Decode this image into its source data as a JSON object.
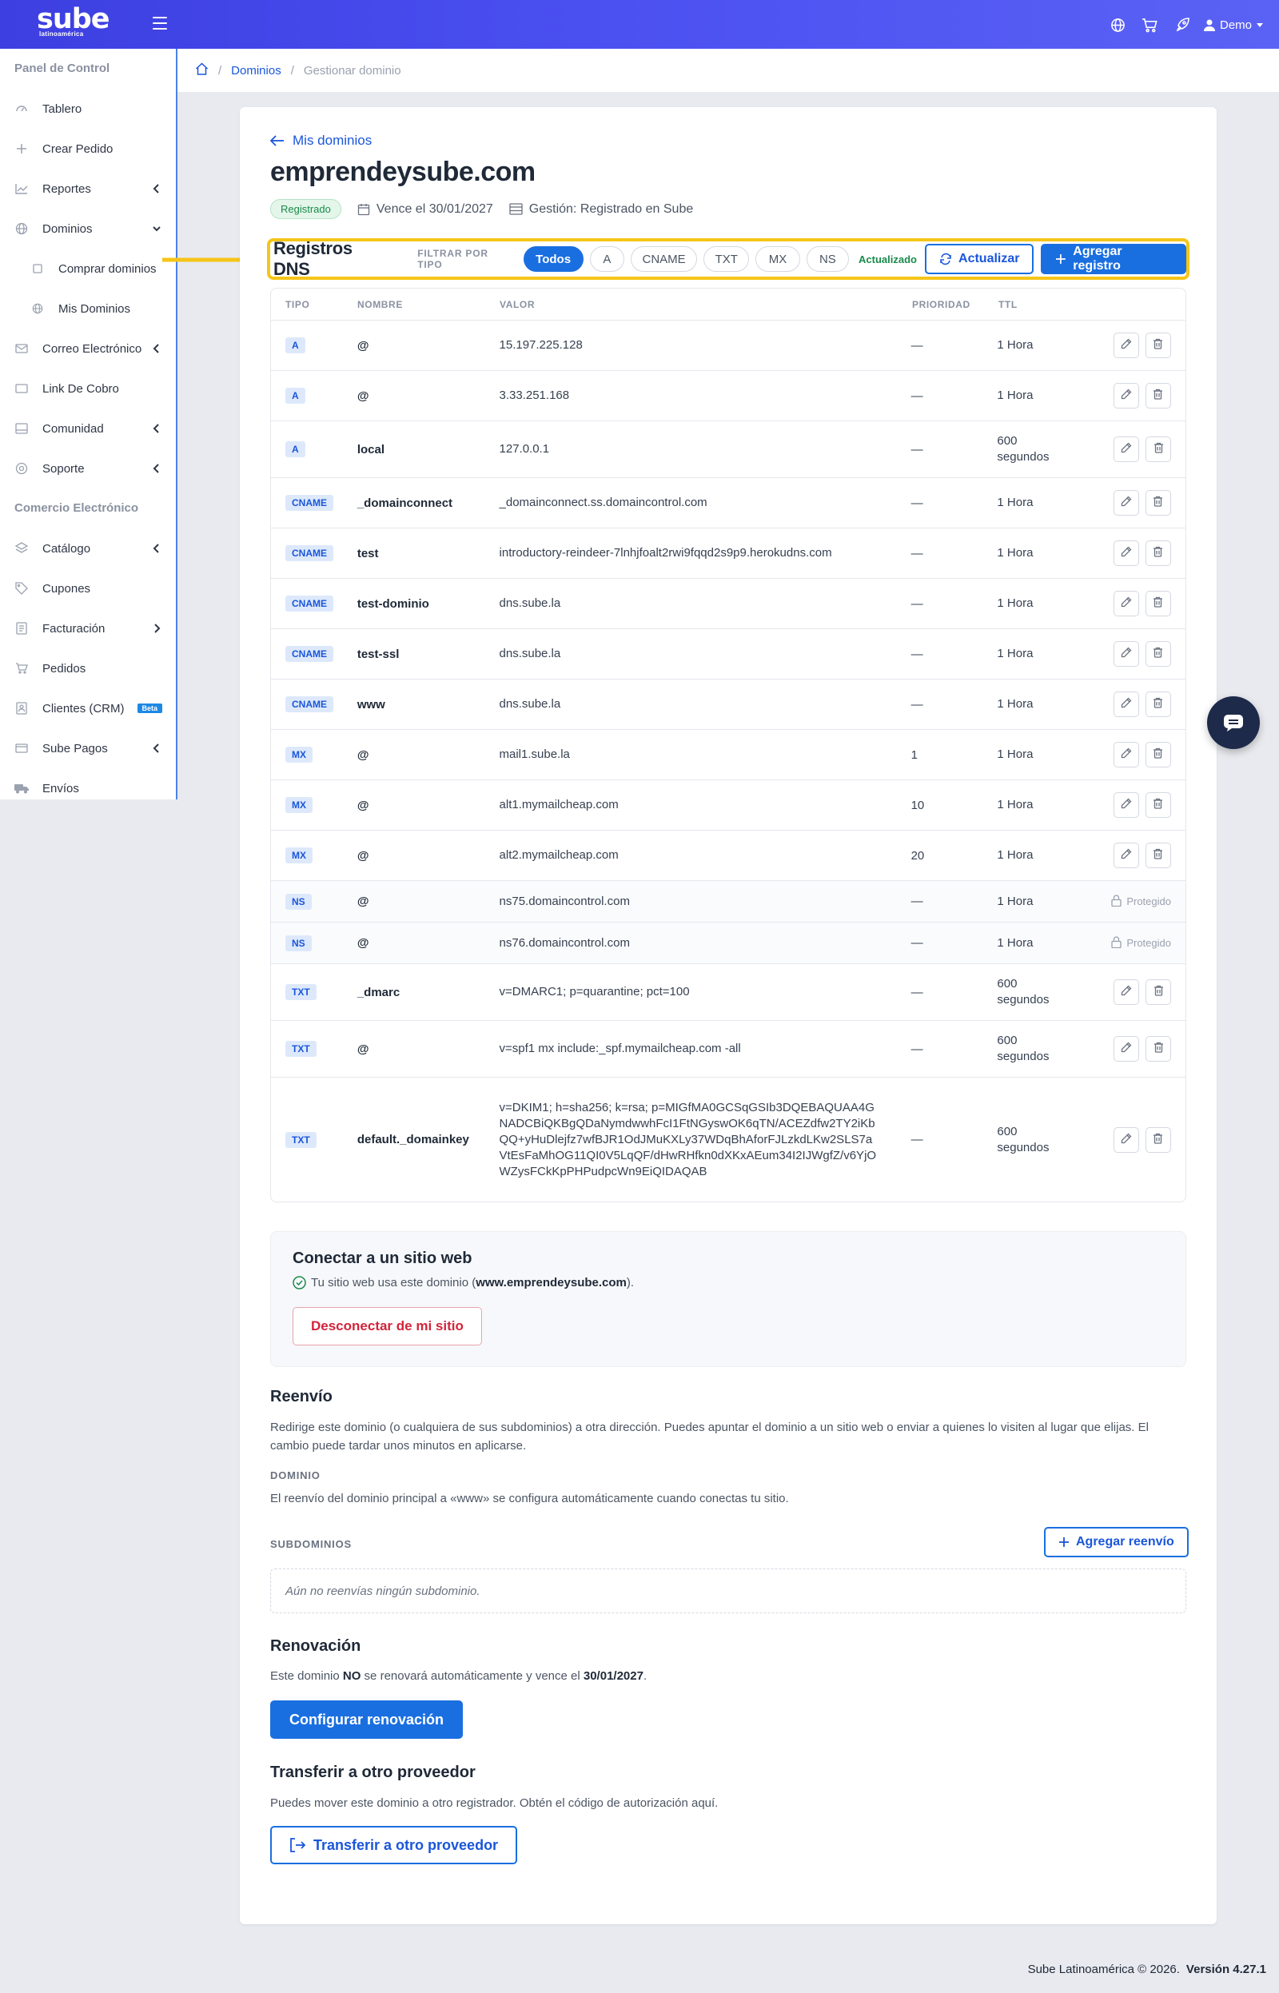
{
  "brand": {
    "logo_main": "sube",
    "logo_sub": "latinoamérica"
  },
  "topbar": {
    "user_label": "Demo"
  },
  "sidebar": {
    "section_panel": "Panel de Control",
    "section_commerce": "Comercio Electrónico",
    "items": [
      {
        "label": "Tablero",
        "icon": "dashboard-icon"
      },
      {
        "label": "Crear Pedido",
        "icon": "plus-icon"
      },
      {
        "label": "Reportes",
        "icon": "chart-icon"
      },
      {
        "label": "Dominios",
        "icon": "globe-icon"
      },
      {
        "label": "Comprar dominios",
        "icon": "cart-icon"
      },
      {
        "label": "Mis Dominios",
        "icon": "globe-icon"
      },
      {
        "label": "Correo Electrónico",
        "icon": "mail-icon"
      },
      {
        "label": "Link De Cobro",
        "icon": "link-icon"
      },
      {
        "label": "Comunidad",
        "icon": "community-icon"
      },
      {
        "label": "Soporte",
        "icon": "support-icon"
      },
      {
        "label": "Catálogo",
        "icon": "layers-icon"
      },
      {
        "label": "Cupones",
        "icon": "tag-icon"
      },
      {
        "label": "Facturación",
        "icon": "invoice-icon"
      },
      {
        "label": "Pedidos",
        "icon": "bag-icon"
      },
      {
        "label": "Clientes (CRM)",
        "icon": "contacts-icon"
      },
      {
        "label": "Sube Pagos",
        "icon": "card-icon"
      },
      {
        "label": "Envíos",
        "icon": "truck-icon"
      }
    ],
    "beta_label": "Beta"
  },
  "breadcrumb": {
    "link": "Dominios",
    "current": "Gestionar dominio"
  },
  "domain": {
    "back_label": "Mis dominios",
    "name": "emprendeysube.com",
    "status": "Registrado",
    "expires": "Vence el 30/01/2027",
    "management": "Gestión: Registrado en Sube"
  },
  "dns": {
    "title": "Registros DNS",
    "filter_label": "FILTRAR POR TIPO",
    "filters": [
      "Todos",
      "A",
      "CNAME",
      "TXT",
      "MX",
      "NS"
    ],
    "updated": "Actualizado",
    "refresh_label": "Actualizar",
    "add_label": "Agregar registro",
    "columns": [
      "TIPO",
      "NOMBRE",
      "VALOR",
      "PRIORIDAD",
      "TTL"
    ],
    "protected_label": "Protegido",
    "rows": [
      {
        "type": "A",
        "name": "@",
        "value": "15.197.225.128",
        "priority": "—",
        "ttl": "1 Hora",
        "locked": false
      },
      {
        "type": "A",
        "name": "@",
        "value": "3.33.251.168",
        "priority": "—",
        "ttl": "1 Hora",
        "locked": false
      },
      {
        "type": "A",
        "name": "local",
        "value": "127.0.0.1",
        "priority": "—",
        "ttl": "600 segundos",
        "locked": false
      },
      {
        "type": "CNAME",
        "name": "_domainconnect",
        "value": "_domainconnect.ss.domaincontrol.com",
        "priority": "—",
        "ttl": "1 Hora",
        "locked": false
      },
      {
        "type": "CNAME",
        "name": "test",
        "value": "introductory-reindeer-7lnhjfoalt2rwi9fqqd2s9p9.herokudns.com",
        "priority": "—",
        "ttl": "1 Hora",
        "locked": false
      },
      {
        "type": "CNAME",
        "name": "test-dominio",
        "value": "dns.sube.la",
        "priority": "—",
        "ttl": "1 Hora",
        "locked": false
      },
      {
        "type": "CNAME",
        "name": "test-ssl",
        "value": "dns.sube.la",
        "priority": "—",
        "ttl": "1 Hora",
        "locked": false
      },
      {
        "type": "CNAME",
        "name": "www",
        "value": "dns.sube.la",
        "priority": "—",
        "ttl": "1 Hora",
        "locked": false
      },
      {
        "type": "MX",
        "name": "@",
        "value": "mail1.sube.la",
        "priority": "1",
        "ttl": "1 Hora",
        "locked": false
      },
      {
        "type": "MX",
        "name": "@",
        "value": "alt1.mymailcheap.com",
        "priority": "10",
        "ttl": "1 Hora",
        "locked": false
      },
      {
        "type": "MX",
        "name": "@",
        "value": "alt2.mymailcheap.com",
        "priority": "20",
        "ttl": "1 Hora",
        "locked": false
      },
      {
        "type": "NS",
        "name": "@",
        "value": "ns75.domaincontrol.com",
        "priority": "—",
        "ttl": "1 Hora",
        "locked": true
      },
      {
        "type": "NS",
        "name": "@",
        "value": "ns76.domaincontrol.com",
        "priority": "—",
        "ttl": "1 Hora",
        "locked": true
      },
      {
        "type": "TXT",
        "name": "_dmarc",
        "value": "v=DMARC1; p=quarantine; pct=100",
        "priority": "—",
        "ttl": "600 segundos",
        "locked": false
      },
      {
        "type": "TXT",
        "name": "@",
        "value": "v=spf1 mx include:_spf.mymailcheap.com -all",
        "priority": "—",
        "ttl": "600 segundos",
        "locked": false
      },
      {
        "type": "TXT",
        "name": "default._domainkey",
        "value": "v=DKIM1; h=sha256; k=rsa; p=MIGfMA0GCSqGSIb3DQEBAQUAA4GNADCBiQKBgQDaNymdwwhFcI1FtNGyswOK6qTN/ACEZdfw2TY2iKbQQ+yHuDlejfz7wfBJR1OdJMuKXLy37WDqBhAforFJLzkdLKw2SLS7aVtEsFaMhOG11QI0V5LqQF/dHwRHfkn0dXKxAEum34I2IJWgfZ/v6YjOWZysFCkKpPHPudpcWn9EiQIDAQAB",
        "priority": "—",
        "ttl": "600 segundos",
        "locked": false
      }
    ]
  },
  "connect": {
    "title": "Conectar a un sitio web",
    "text_before": "Tu sitio web usa este dominio (",
    "site": "www.emprendeysube.com",
    "text_after": ").",
    "disconnect_label": "Desconectar de mi sitio"
  },
  "forwarding": {
    "title": "Reenvío",
    "description": "Redirige este dominio (o cualquiera de sus subdominios) a otra dirección. Puedes apuntar el dominio a un sitio web o enviar a quienes lo visiten al lugar que elijas. El cambio puede tardar unos minutos en aplicarse.",
    "domain_label": "DOMINIO",
    "domain_note": "El reenvío del dominio principal a «www» se configura automáticamente cuando conectas tu sitio.",
    "subdomains_label": "SUBDOMINIOS",
    "add_label": "Agregar reenvío",
    "empty": "Aún no reenvías ningún subdominio."
  },
  "renewal": {
    "title": "Renovación",
    "text_before": "Este dominio ",
    "text_no": "NO",
    "text_middle": " se renovará automáticamente y vence el ",
    "date": "30/01/2027",
    "text_end": ".",
    "button": "Configurar renovación"
  },
  "transfer": {
    "title": "Transferir a otro proveedor",
    "text": "Puedes mover este dominio a otro registrador. Obtén el código de autorización aquí.",
    "button": "Transferir a otro proveedor"
  },
  "footer": {
    "copyright": "Sube Latinoamérica © 2026.",
    "version": "Versión 4.27.1"
  },
  "colors": {
    "primary": "#1a6fe0",
    "highlight": "#f5c518",
    "success": "#1a8a4a",
    "danger": "#d3243a"
  }
}
